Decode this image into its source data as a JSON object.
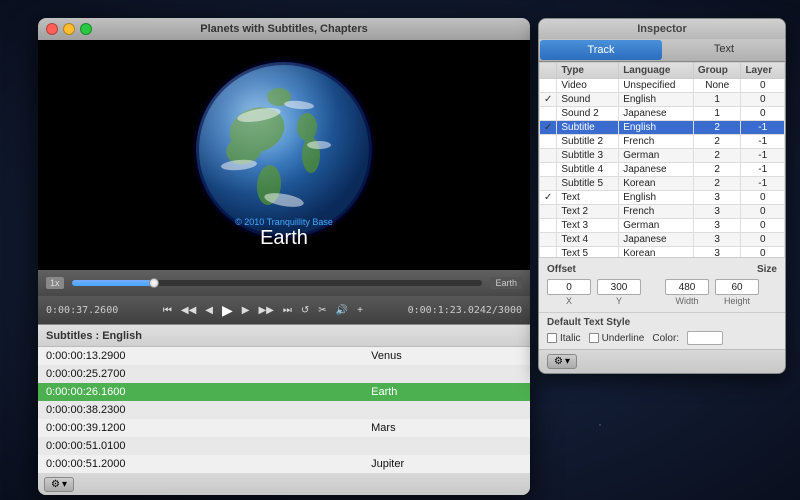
{
  "playerWindow": {
    "title": "Planets with Subtitles, Chapters",
    "videoLabel": "Earth",
    "tranquilityText": "© 2010 Tranquillity Base",
    "timeLeft": "0:00:37.2600",
    "timeRight": "0:00:1:23.0242/3000",
    "speedLabel": "1x",
    "chapterLabel": "Earth",
    "progressPercent": 20
  },
  "subtitleList": {
    "header": "Subtitles : English",
    "rows": [
      {
        "time": "0:00:00:13.2900",
        "text": "Venus",
        "active": false
      },
      {
        "time": "0:00:00:25.2700",
        "text": "",
        "active": false
      },
      {
        "time": "0:00:00:26.1600",
        "text": "Earth",
        "active": true
      },
      {
        "time": "0:00:00:38.2300",
        "text": "",
        "active": false
      },
      {
        "time": "0:00:00:39.1200",
        "text": "Mars",
        "active": false
      },
      {
        "time": "0:00:00:51.0100",
        "text": "",
        "active": false
      },
      {
        "time": "0:00:00:51.2000",
        "text": "Jupiter",
        "active": false
      }
    ]
  },
  "inspector": {
    "title": "Inspector",
    "tabs": [
      "Track",
      "Text"
    ],
    "activeTab": 0,
    "columns": [
      "",
      "Type",
      "Language",
      "Group",
      "Layer"
    ],
    "tracks": [
      {
        "checked": false,
        "type": "Video",
        "language": "Unspecified",
        "group": "None",
        "layer": "0",
        "highlighted": false
      },
      {
        "checked": true,
        "type": "Sound",
        "language": "English",
        "group": "1",
        "layer": "0",
        "highlighted": false
      },
      {
        "checked": false,
        "type": "Sound 2",
        "language": "Japanese",
        "group": "1",
        "layer": "0",
        "highlighted": false
      },
      {
        "checked": true,
        "type": "Subtitle",
        "language": "English",
        "group": "2",
        "layer": "-1",
        "highlighted": true
      },
      {
        "checked": false,
        "type": "Subtitle 2",
        "language": "French",
        "group": "2",
        "layer": "-1",
        "highlighted": false
      },
      {
        "checked": false,
        "type": "Subtitle 3",
        "language": "German",
        "group": "2",
        "layer": "-1",
        "highlighted": false
      },
      {
        "checked": false,
        "type": "Subtitle 4",
        "language": "Japanese",
        "group": "2",
        "layer": "-1",
        "highlighted": false
      },
      {
        "checked": false,
        "type": "Subtitle 5",
        "language": "Korean",
        "group": "2",
        "layer": "-1",
        "highlighted": false
      },
      {
        "checked": true,
        "type": "Text",
        "language": "English",
        "group": "3",
        "layer": "0",
        "highlighted": false
      },
      {
        "checked": false,
        "type": "Text 2",
        "language": "French",
        "group": "3",
        "layer": "0",
        "highlighted": false
      },
      {
        "checked": false,
        "type": "Text 3",
        "language": "German",
        "group": "3",
        "layer": "0",
        "highlighted": false
      },
      {
        "checked": false,
        "type": "Text 4",
        "language": "Japanese",
        "group": "3",
        "layer": "0",
        "highlighted": false
      },
      {
        "checked": false,
        "type": "Text 5",
        "language": "Korean",
        "group": "3",
        "layer": "0",
        "highlighted": false
      }
    ],
    "offset": {
      "x": "0",
      "y": "300",
      "label_x": "X",
      "label_y": "Y"
    },
    "size": {
      "width": "480",
      "height": "60",
      "label_w": "Width",
      "label_h": "Height"
    },
    "offsetLabel": "Offset",
    "sizeLabel": "Size",
    "defaultTextStyle": "Default Text Style",
    "italic": "Italic",
    "underline": "Underline",
    "colorLabel": "Color:"
  }
}
